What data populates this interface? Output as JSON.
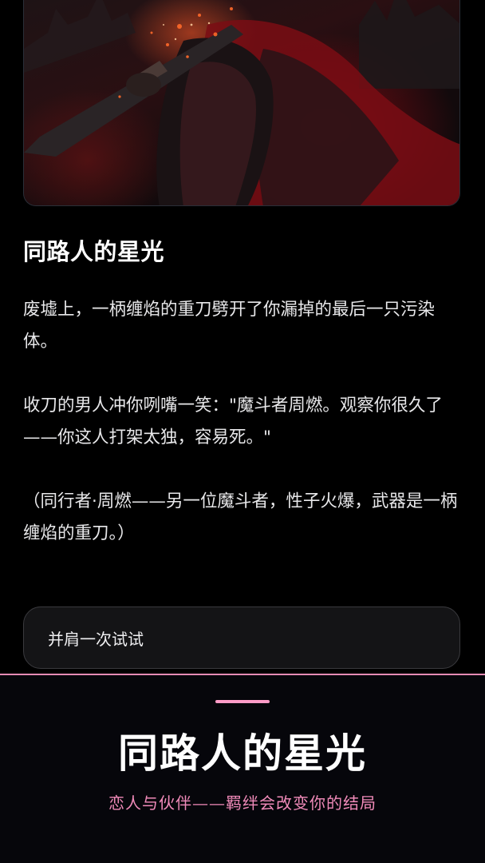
{
  "scene": {
    "image_icon": "warrior-with-flaming-blade-illustration"
  },
  "story": {
    "title": "同路人的星光",
    "paragraphs": [
      "废墟上，一柄缠焰的重刀劈开了你漏掉的最后一只污染体。",
      "收刀的男人冲你咧嘴一笑：\"魔斗者周燃。观察你很久了——你这人打架太独，容易死。\"",
      "（同行者·周燃——另一位魔斗者，性子火爆，武器是一柄缠焰的重刀。）"
    ]
  },
  "choice": {
    "label": "并肩一次试试"
  },
  "banner": {
    "title": "同路人的星光",
    "subtitle": "恋人与伙伴——羁绊会改变你的结局",
    "accent_color": "#ff9cc8",
    "subtitle_color": "#f08ab9"
  }
}
